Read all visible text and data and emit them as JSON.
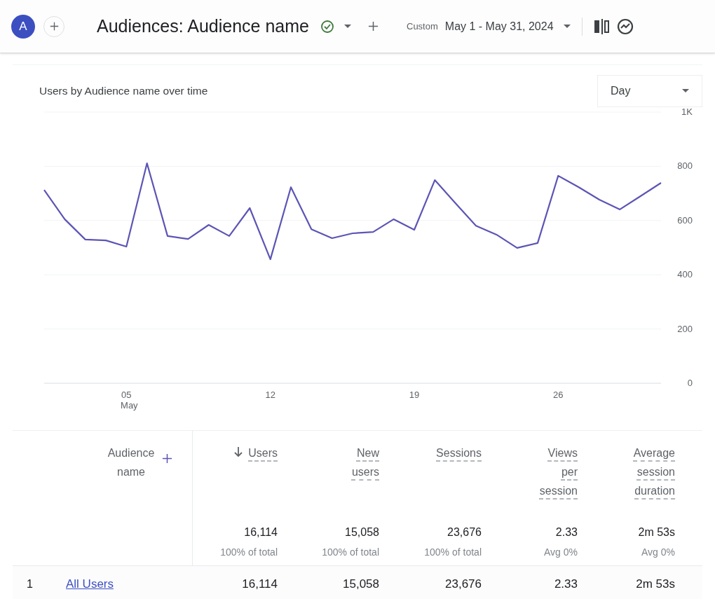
{
  "header": {
    "avatar": "A",
    "title": "Audiences: Audience name",
    "date_label": "Custom",
    "date_range": "May 1 - May 31, 2024"
  },
  "chart_card": {
    "title": "Users by Audience name over time",
    "granularity": "Day",
    "chart_data": {
      "type": "line",
      "x": [
        1,
        2,
        3,
        4,
        5,
        6,
        7,
        8,
        9,
        10,
        11,
        12,
        13,
        14,
        15,
        16,
        17,
        18,
        19,
        20,
        21,
        22,
        23,
        24,
        25,
        26,
        27,
        28,
        29,
        30,
        31
      ],
      "xlim": [
        1,
        31
      ],
      "grid": true,
      "xlabel": "May",
      "series": [
        {
          "color": "#5c55b5",
          "values": [
            713,
            605,
            530,
            527,
            504,
            811,
            543,
            532,
            584,
            543,
            646,
            457,
            723,
            568,
            535,
            553,
            558,
            605,
            566,
            749,
            664,
            581,
            548,
            499,
            517,
            765,
            723,
            677,
            641,
            690,
            739
          ]
        }
      ],
      "ylim": [
        0,
        1000
      ],
      "yticks": [
        0,
        200,
        400,
        600,
        800,
        {
          "value": 1000,
          "label": "1K"
        }
      ],
      "xticks": [
        {
          "value": 5,
          "label": "05"
        },
        {
          "value": 12,
          "label": "12"
        },
        {
          "value": 19,
          "label": "19"
        },
        {
          "value": 26,
          "label": "26"
        }
      ]
    }
  },
  "table": {
    "first_column": "Audience name",
    "columns": [
      {
        "label": "Users",
        "sorted": true,
        "total": "16,114",
        "total_note": "100% of total"
      },
      {
        "label": "New users",
        "sorted": false,
        "total": "15,058",
        "total_note": "100% of total"
      },
      {
        "label": "Sessions",
        "sorted": false,
        "total": "23,676",
        "total_note": "100% of total"
      },
      {
        "label": "Views per session",
        "sorted": false,
        "total": "2.33",
        "total_note": "Avg 0%"
      },
      {
        "label": "Average session duration",
        "sorted": false,
        "total": "2m 53s",
        "total_note": "Avg 0%"
      }
    ],
    "rows": [
      {
        "index": "1",
        "name": "All Users",
        "values": [
          "16,114",
          "15,058",
          "23,676",
          "2.33",
          "2m 53s"
        ]
      }
    ]
  }
}
